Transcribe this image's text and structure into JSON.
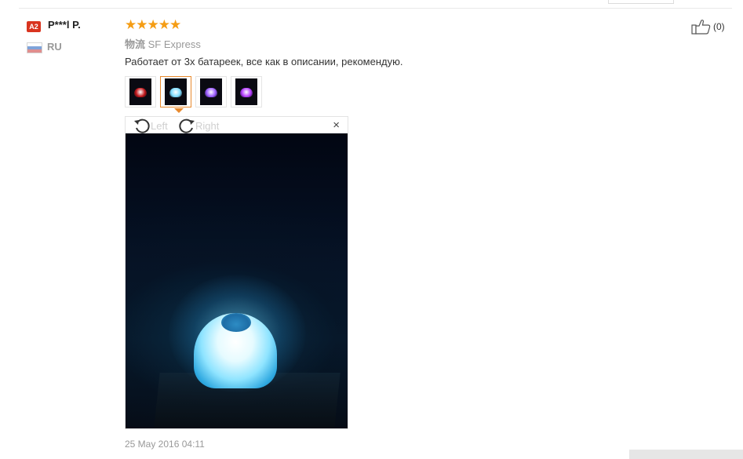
{
  "reviewer": {
    "level_badge": "A2",
    "name": "P***l P.",
    "country": "RU",
    "flag_icon": "russia-flag-icon"
  },
  "review": {
    "rating": 5,
    "rating_max": 5,
    "star_color": "#f59d14",
    "logistics_label": "物流",
    "logistics_value": "SF Express",
    "text": "Работает от 3х батареек, все как в описании, рекомендую.",
    "date": "25 May 2016 04:11"
  },
  "thumbnails": [
    {
      "color": "#c0161a",
      "selected": false
    },
    {
      "color": "#7fdcff",
      "selected": true
    },
    {
      "color": "#9b5cff",
      "selected": false
    },
    {
      "color": "#b43cff",
      "selected": false
    }
  ],
  "viewer": {
    "rotate_left_label": "Left",
    "rotate_right_label": "Right",
    "close_symbol": "×"
  },
  "helpful": {
    "icon": "thumbs-up-icon",
    "count_text": "(0)"
  },
  "colors": {
    "accent_orange": "#e88a2e",
    "badge_red": "#d9341f"
  }
}
